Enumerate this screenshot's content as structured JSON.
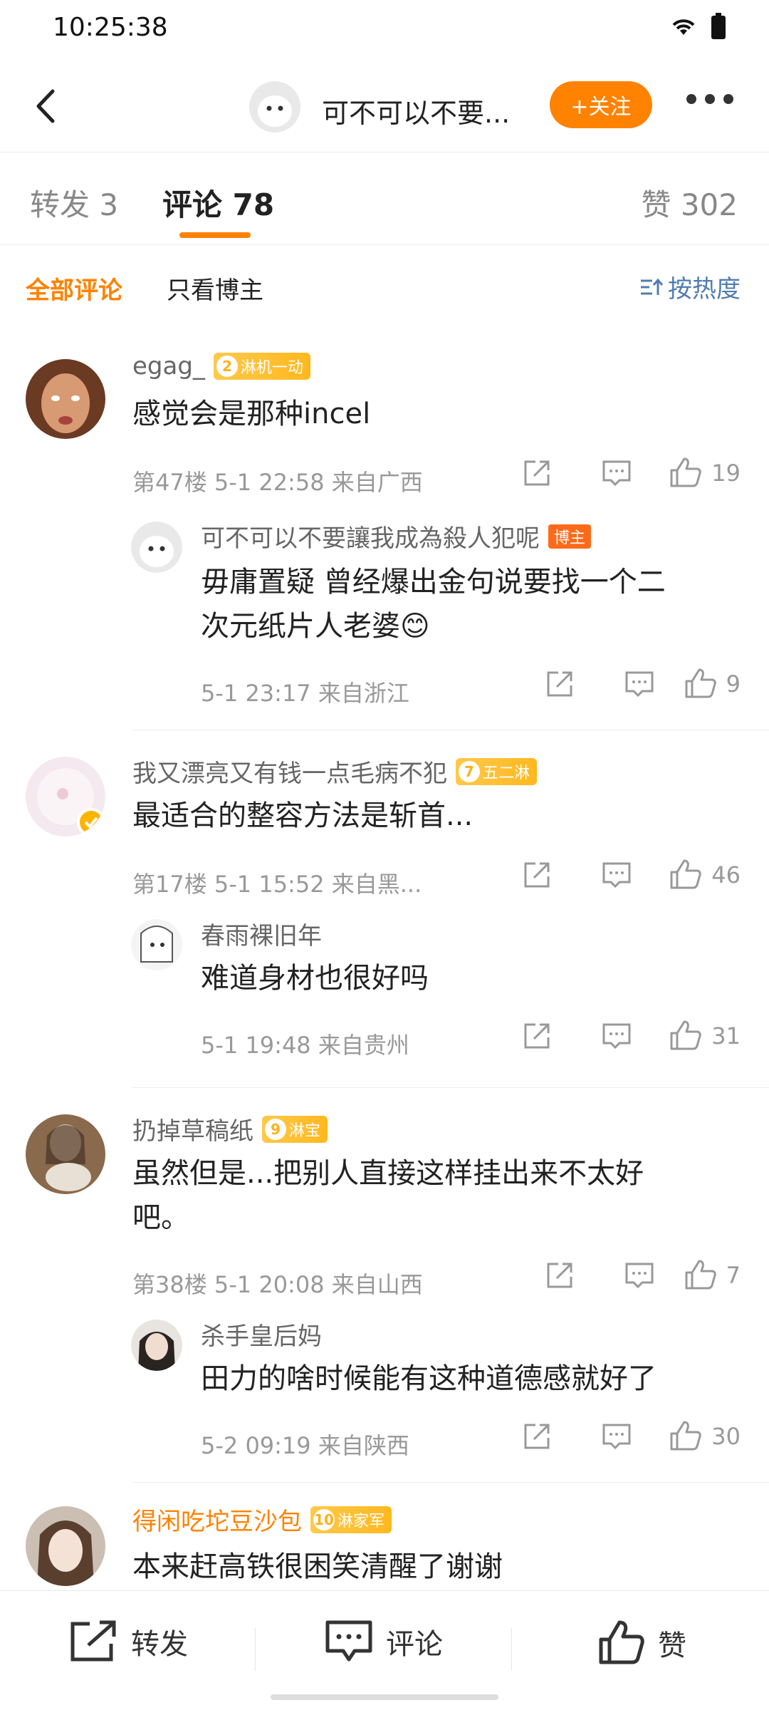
{
  "status_bar": {
    "time": "10:25:38"
  },
  "navbar": {
    "title": "可不可以不要...",
    "follow_label": "+关注"
  },
  "tabs": {
    "repost": "转发 3",
    "comments": "评论 78",
    "likes": "赞 302"
  },
  "filter": {
    "all": "全部评论",
    "author_only": "只看博主",
    "sort": "按热度"
  },
  "comments": [
    {
      "name": "egag_",
      "badge_level": "2",
      "badge_text": "淋机一动",
      "text": "感觉会是那种incel",
      "meta": "第47楼  5-1 22:58  来自广西",
      "likes": "19",
      "reply": {
        "name": "可不可以不要讓我成為殺人犯呢",
        "tag": "博主",
        "text_line1": "毋庸置疑 曾经爆出金句说要找一个二",
        "text_line2": "次元纸片人老婆😊",
        "meta": "5-1 23:17  来自浙江",
        "likes": "9"
      }
    },
    {
      "name": "我又漂亮又有钱一点毛病不犯",
      "badge_level": "7",
      "badge_text": "五二淋",
      "text": "最适合的整容方法是斩首...",
      "meta": "第17楼  5-1 15:52  来自黑...",
      "likes": "46",
      "reply": {
        "name": "春雨裸旧年",
        "text_line1": "难道身材也很好吗",
        "meta": "5-1 19:48  来自贵州",
        "likes": "31"
      }
    },
    {
      "name": "扔掉草稿纸",
      "badge_level": "9",
      "badge_text": "淋宝",
      "text_line1": "虽然但是...把别人直接这样挂出来不太好",
      "text_line2": "吧。",
      "meta": "第38楼  5-1 20:08  来自山西",
      "likes": "7",
      "reply": {
        "name": "杀手皇后妈",
        "text_line1": "田力的啥时候能有这种道德感就好了",
        "meta": "5-2 09:19  来自陕西",
        "likes": "30"
      }
    },
    {
      "name": "得闲吃坨豆沙包",
      "badge_level": "10",
      "badge_text": "淋家军",
      "text": "本来赶高铁很困笑清醒了谢谢"
    }
  ],
  "bottom_bar": {
    "repost": "转发",
    "comment": "评论",
    "like": "赞"
  },
  "colors": {
    "accent": "#ff8200",
    "link": "#507daf",
    "text": "#222222",
    "meta": "#999999"
  }
}
